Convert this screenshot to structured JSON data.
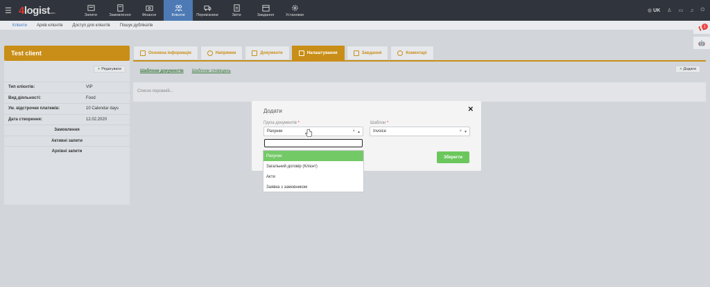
{
  "app": {
    "logo_digit": "4",
    "logo_text": "logist",
    "logo_suffix": ".com"
  },
  "nav": [
    {
      "label": "Запити",
      "icon": "requests-icon"
    },
    {
      "label": "Замовлення",
      "icon": "orders-icon"
    },
    {
      "label": "Фінанси",
      "icon": "finance-icon"
    },
    {
      "label": "Клієнти",
      "icon": "clients-icon",
      "active": true
    },
    {
      "label": "Перевізники",
      "icon": "carriers-icon"
    },
    {
      "label": "Звіти",
      "icon": "reports-icon"
    },
    {
      "label": "Завдання",
      "icon": "tasks-icon"
    },
    {
      "label": "Установки",
      "icon": "settings-icon"
    }
  ],
  "topright": {
    "lang": "UK"
  },
  "subnav": [
    "Клієнти",
    "Архів клієнтів",
    "Доступ для клієнтів",
    "Пошук дублікатів"
  ],
  "side_badge": "1",
  "client": {
    "name": "Test client",
    "edit_label": "Редагувати",
    "rows": [
      {
        "label": "Тип клієнтів:",
        "value": "VIP"
      },
      {
        "label": "Вид діяльності:",
        "value": "Food"
      },
      {
        "label": "Ум. відстрочки платежів:",
        "value": "10 Calendar days"
      },
      {
        "label": "Дата створення:",
        "value": "12.02.2020"
      }
    ],
    "links": [
      "Замовлення",
      "Активні запити",
      "Архівні запити"
    ]
  },
  "tabs": [
    {
      "label": "Основна інформація"
    },
    {
      "label": "Напрямки"
    },
    {
      "label": "Документи"
    },
    {
      "label": "Налаштування",
      "active": true
    },
    {
      "label": "Завдання"
    },
    {
      "label": "Коментарі"
    }
  ],
  "subtabs": [
    "Шаблони документів",
    "Шаблони сповіщень"
  ],
  "add_label": "Додати",
  "empty_list": "Список порожній...",
  "modal": {
    "title": "Додати",
    "group_label": "Група документів",
    "group_value": "Рахунки",
    "template_label": "Шаблон",
    "template_value": "Invoice",
    "save_label": "Зберегти"
  },
  "dropdown_options": [
    "Рахунки",
    "Загальний договір (Клієнт)",
    "Акти",
    "Заявка з замовником"
  ],
  "colors": {
    "accent": "#c98e17",
    "nav_active": "#4d7ab5",
    "save": "#6bc75c",
    "topbar": "#30353d"
  }
}
